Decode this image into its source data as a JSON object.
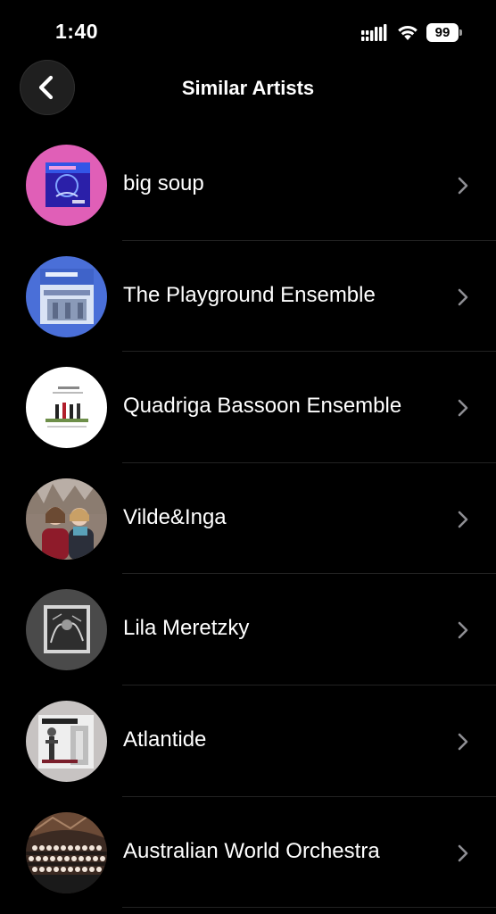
{
  "status_bar": {
    "time": "1:40",
    "battery_level": "99"
  },
  "nav": {
    "title": "Similar Artists",
    "back_icon": "chevron-left-icon"
  },
  "artists": [
    {
      "name": "big soup",
      "avatar": "album-art-pink-blue"
    },
    {
      "name": "The Playground Ensemble",
      "avatar": "album-art-blue-building"
    },
    {
      "name": "Quadriga Bassoon Ensemble",
      "avatar": "album-art-white-quartet"
    },
    {
      "name": "Vilde&Inga",
      "avatar": "photo-two-women"
    },
    {
      "name": "Lila Meretzky",
      "avatar": "album-art-grey-sketch"
    },
    {
      "name": "Atlantide",
      "avatar": "album-art-statue"
    },
    {
      "name": "Australian World Orchestra",
      "avatar": "photo-orchestra"
    }
  ],
  "colors": {
    "background": "#000000",
    "text": "#ffffff",
    "chevron": "#8e8e93",
    "separator": "#222222"
  }
}
